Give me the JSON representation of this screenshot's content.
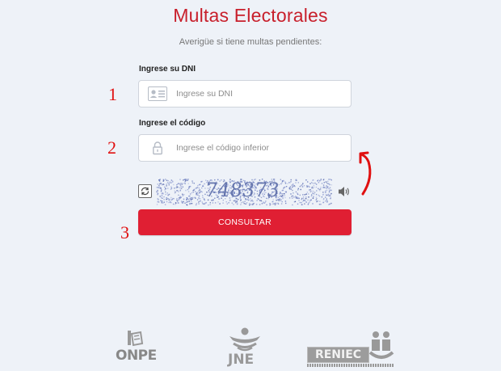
{
  "header": {
    "title": "Multas Electorales",
    "subtitle": "Averigüe si tiene multas pendientes:"
  },
  "form": {
    "dni_label": "Ingrese su DNI",
    "dni_placeholder": "Ingrese su DNI",
    "dni_icon": "id-card-icon",
    "code_label": "Ingrese el código",
    "code_placeholder": "Ingrese el código inferior",
    "code_icon": "lock-icon",
    "captcha_value": "748373",
    "refresh_icon": "refresh-icon",
    "audio_icon": "speaker-icon",
    "submit_label": "CONSULTAR"
  },
  "annotations": {
    "step1": "1",
    "step2": "2",
    "step3": "3",
    "color": "#e01010"
  },
  "footer": {
    "logos": [
      {
        "name": "ONPE",
        "text": "ONPE"
      },
      {
        "name": "JNE",
        "text": "JNE"
      },
      {
        "name": "RENIEC",
        "text": "RENIEC"
      }
    ]
  },
  "colors": {
    "brand_red": "#c8202c",
    "button_red": "#e01f33",
    "background": "#eef2f8"
  }
}
